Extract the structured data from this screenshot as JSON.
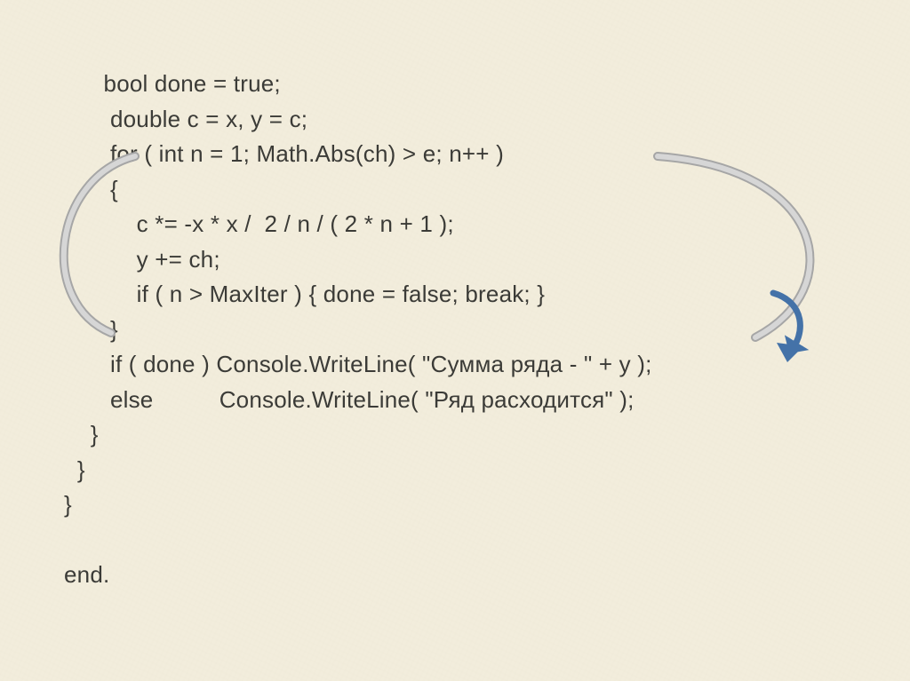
{
  "code": {
    "l1": "      bool done = true;",
    "l2": "       double c = x, y = c;",
    "l3": "       for ( int n = 1; Math.Abs(ch) > e; n++ )",
    "l4": "       {",
    "l5": "           c *= -x * x /  2 / n / ( 2 * n + 1 );",
    "l6": "           y += ch;",
    "l7": "           if ( n > MaxIter ) { done = false; break; }",
    "l8": "       }",
    "l9": "       if ( done ) Console.WriteLine( \"Сумма ряда - \" + y );",
    "l10": "       else          Console.WriteLine( \"Ряд расходится\" );",
    "l11": "    }",
    "l12": "  }",
    "l13": "}",
    "l14": "",
    "l15": "end."
  },
  "arrow": {
    "color_gray_outer": "#a6a6a6",
    "color_gray_inner": "#d6d6d6",
    "color_blue": "#4472a8"
  }
}
